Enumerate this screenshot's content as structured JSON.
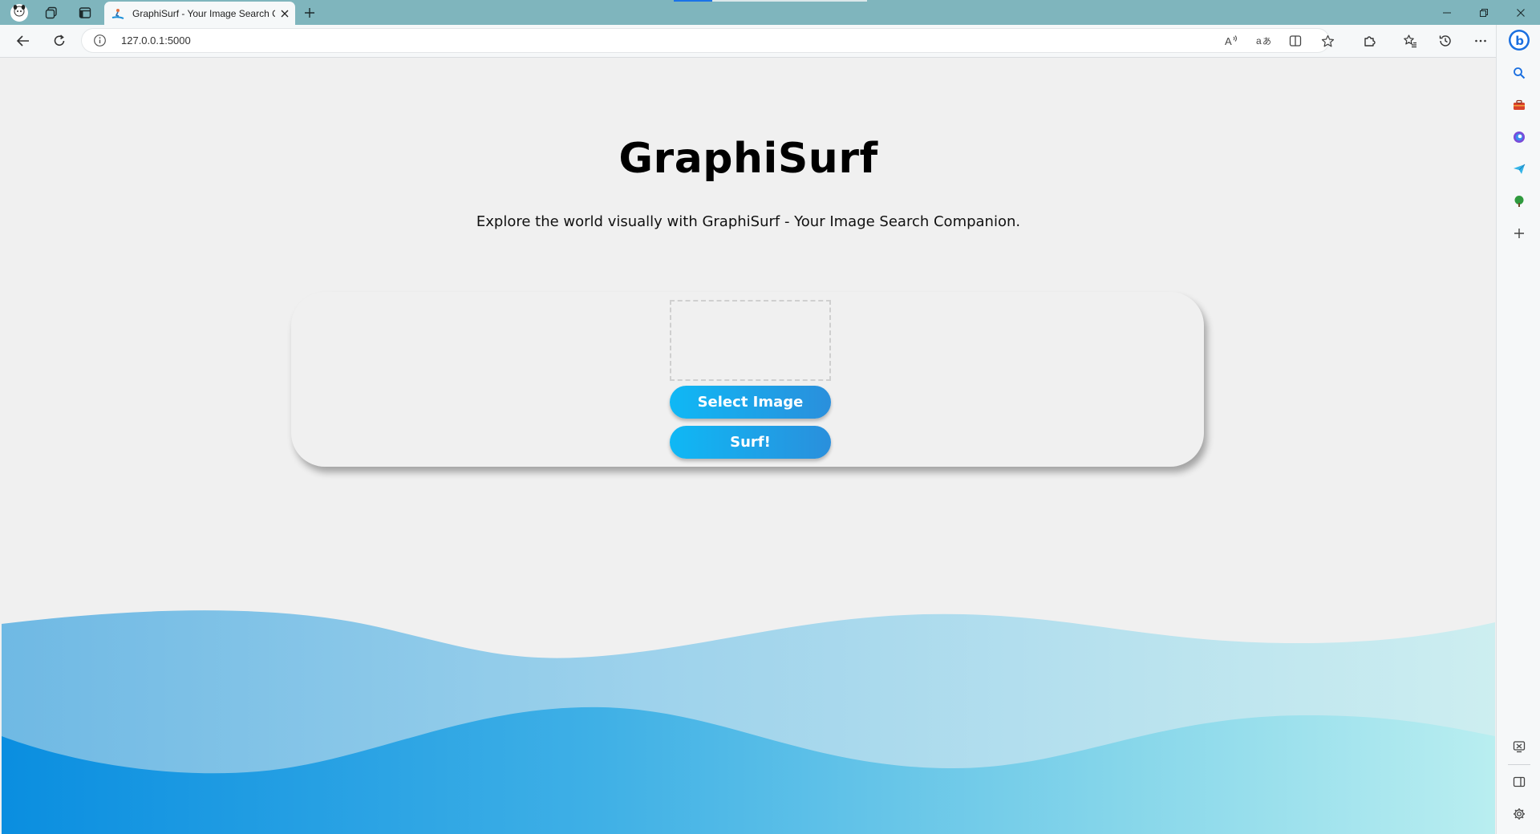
{
  "browser": {
    "tab": {
      "title": "GraphiSurf - Your Image Search Companion"
    },
    "address": {
      "url": "127.0.0.1:5000"
    },
    "icons": {
      "profile": "profile-avatar-icon",
      "workspaces": "workspaces-icon",
      "tab_actions": "vertical-tabs-icon",
      "favicon": "surfer-favicon",
      "close_tab": "close-icon",
      "new_tab": "plus-icon",
      "minimize": "minimize-icon",
      "restore": "restore-icon",
      "close_window": "close-icon",
      "back": "back-arrow-icon",
      "refresh": "refresh-icon",
      "site_info": "info-icon",
      "read_aloud": "read-aloud-icon",
      "translate": "translate-icon",
      "split_screen": "split-screen-icon",
      "favorite": "star-icon",
      "extensions": "puzzle-icon",
      "favorites": "favorites-icon",
      "history": "history-icon",
      "more": "ellipsis-icon"
    },
    "sidebar_icons": [
      "bing-copilot-icon",
      "search-icon",
      "toolbox-icon",
      "office-icon",
      "send-icon",
      "tree-icon",
      "plus-icon",
      "screenshot-icon",
      "sidebar-toggle-icon",
      "settings-gear-icon"
    ]
  },
  "page": {
    "title": "GraphiSurf",
    "subtitle": "Explore the world visually with GraphiSurf - Your Image Search Companion.",
    "select_button": "Select Image",
    "surf_button": "Surf!"
  },
  "colors": {
    "titlebar": "#7fb5bd",
    "page_background": "#f0f0f0",
    "button_start": "#0fb8f5",
    "button_end": "#2a8fdc",
    "wave_deep": "#0a8ee0",
    "wave_light": "#b9eef0"
  }
}
